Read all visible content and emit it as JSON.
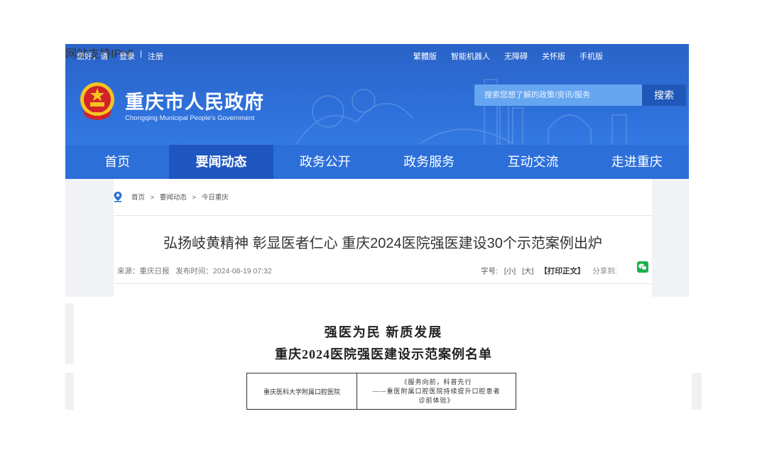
{
  "topbar": {
    "greeting": "您好，请",
    "login": "登录",
    "separator": "|",
    "register": "注册",
    "links": [
      "繁體版",
      "智能机器人",
      "无障碍",
      "关怀版",
      "手机版"
    ],
    "ipv6": "网站支持IPv6"
  },
  "brand": {
    "name_cn": "重庆市人民政府",
    "name_en": "Chongqing Municipal People's Government",
    "colors": {
      "header": "#2f72dd",
      "nav_active": "#1f56c0",
      "emblem": "#c8161d"
    }
  },
  "search": {
    "placeholder": "搜索您想了解的政策/资讯/服务",
    "button": "搜索"
  },
  "nav": {
    "items": [
      "首页",
      "要闻动态",
      "政务公开",
      "政务服务",
      "互动交流",
      "走进重庆"
    ],
    "active": "要闻动态"
  },
  "breadcrumb": {
    "items": [
      "首页",
      "要闻动态",
      "今日重庆"
    ],
    "separator": ">"
  },
  "article": {
    "title": "弘扬岐黄精神 彰显医者仁心 重庆2024医院强医建设30个示范案例出炉",
    "source": "来源：重庆日报",
    "published": "发布时间：2024-08-19 07:32",
    "font_size_label": "字号:",
    "size_small": "[小]",
    "size_large": "[大]",
    "print": "【打印正文】",
    "share": "分享到:",
    "share_icon": "wechat-icon"
  },
  "document_image": {
    "heading_line1": "强医为民  新质发展",
    "heading_line2": "重庆2024医院强医建设示范案例名单",
    "table": [
      {
        "hospital": "重庆医科大学附属口腔医院",
        "case_lines": [
          "《服务向前，科普先行",
          "——重医附属口腔医院持续提升口腔患者",
          "诊前体验》"
        ]
      }
    ]
  }
}
